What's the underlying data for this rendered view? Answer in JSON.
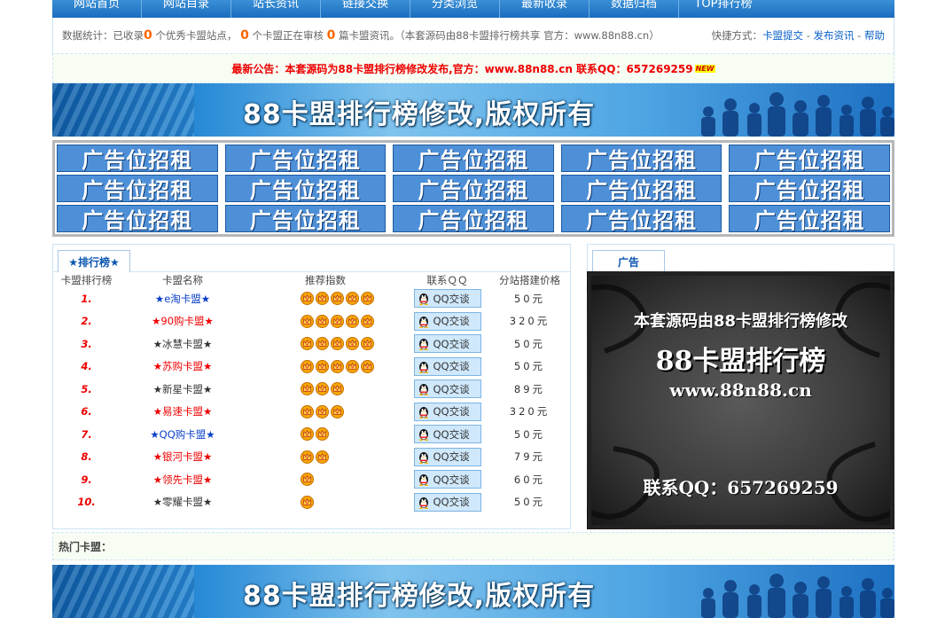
{
  "nav": [
    "网站首页",
    "网站目录",
    "站长资讯",
    "链接交换",
    "分类浏览",
    "最新收录",
    "数据归档",
    "TOP排行榜"
  ],
  "stats": {
    "prefix": "数据统计：已收录",
    "n1": "0",
    "t1": "个优秀卡盟站点，",
    "n2": "0",
    "t2": "个卡盟正在审核",
    "n3": "0",
    "t3": "篇卡盟资讯。（本套源码由88卡盟排行榜共享 官方：www.88n88.cn）",
    "quick_label": "快捷方式：",
    "quick_links": [
      "卡盟提交",
      "发布资讯",
      "帮助"
    ]
  },
  "notice": {
    "text": "最新公告：本套源码为88卡盟排行榜修改发布,官方：www.88n88.cn 联系QQ：657269259",
    "badge": "NEW"
  },
  "banner": {
    "title": "88卡盟排行榜修改,版权所有"
  },
  "ads": {
    "label": "广告位招租",
    "count": 15
  },
  "ranking": {
    "tab": "★排行榜★",
    "headers": [
      "卡盟排行榜",
      "卡盟名称",
      "推荐指数",
      "联系ＱＱ",
      "分站搭建价格"
    ],
    "qq_label": "QQ交谈",
    "rows": [
      {
        "rank": "1.",
        "name": "★e淘卡盟★",
        "color": "blue",
        "stars": 5,
        "price": "50元"
      },
      {
        "rank": "2.",
        "name": "★90购卡盟★",
        "color": "red",
        "stars": 5,
        "price": "320元"
      },
      {
        "rank": "3.",
        "name": "★冰慧卡盟★",
        "color": "black",
        "stars": 5,
        "price": "50元"
      },
      {
        "rank": "4.",
        "name": "★苏购卡盟★",
        "color": "red",
        "stars": 5,
        "price": "50元"
      },
      {
        "rank": "5.",
        "name": "★新星卡盟★",
        "color": "black",
        "stars": 3,
        "price": "89元"
      },
      {
        "rank": "6.",
        "name": "★易速卡盟★",
        "color": "red",
        "stars": 3,
        "price": "320元"
      },
      {
        "rank": "7.",
        "name": "★QQ购卡盟★",
        "color": "blue",
        "stars": 2,
        "price": "50元"
      },
      {
        "rank": "8.",
        "name": "★银河卡盟★",
        "color": "red",
        "stars": 2,
        "price": "79元"
      },
      {
        "rank": "9.",
        "name": "★领先卡盟★",
        "color": "red",
        "stars": 1,
        "price": "60元"
      },
      {
        "rank": "10.",
        "name": "★零耀卡盟★",
        "color": "black",
        "stars": 1,
        "price": "50元"
      }
    ]
  },
  "side_ad": {
    "tab": "广告",
    "line1": "本套源码由88卡盟排行榜修改",
    "line2": "88卡盟排行榜",
    "line3": "www.88n88.cn",
    "line4": "联系QQ：657269259"
  },
  "hot": {
    "label": "热门卡盟："
  }
}
